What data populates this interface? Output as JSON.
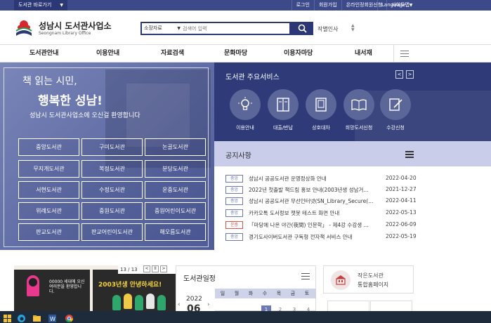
{
  "topbar": {
    "site_select": "도서관 바로가기",
    "links": [
      "로그인",
      "회원가입",
      "온라인정회원신청",
      "사이트맵"
    ],
    "language": "Language"
  },
  "header": {
    "logo_kor": "성남시 도서관사업소",
    "logo_eng": "Seongnam Library Office",
    "search_category": "소장자료",
    "search_placeholder": "검색어 입력",
    "work_label": "작별인사"
  },
  "gnb": {
    "items": [
      "도서관안내",
      "이용안내",
      "자료검색",
      "문화마당",
      "이용자마당",
      "내서재"
    ]
  },
  "hero": {
    "line1": "책 읽는 시민,",
    "line2": "행복한 성남!",
    "line3": "성남시 도서관사업소에 오신걸 환영합니다",
    "branches": [
      "중앙도서관",
      "구미도서관",
      "논골도서관",
      "무지개도서관",
      "복정도서관",
      "분당도서관",
      "서현도서관",
      "수정도서관",
      "운중도서관",
      "위례도서관",
      "중원도서관",
      "중원어린이도서관",
      "판교도서관",
      "판교어린이도서관",
      "해오름도서관"
    ]
  },
  "services": {
    "title": "도서관 주요서비스",
    "items": [
      "이용안내",
      "대출/반납",
      "상호대차",
      "희망도서신청",
      "수강신청"
    ]
  },
  "notice": {
    "title": "공지사항",
    "rows": [
      {
        "badge": "중앙",
        "text": "성남시 공공도서관 운영정상화 안내",
        "date": "2022-04-20",
        "color": "#6c79b4"
      },
      {
        "badge": "중앙",
        "text": "2022년 첫출발 책드림 홍보 안내(2003년생 성남거...",
        "date": "2021-12-27",
        "color": "#6c79b4"
      },
      {
        "badge": "중앙",
        "text": "성남시 공공도서관 무선인터넷(SN_Library_Secure(...",
        "date": "2022-04-11",
        "color": "#6c79b4"
      },
      {
        "badge": "중앙",
        "text": "카카오톡 도서정보 챗봇 테스트 화면 안내",
        "date": "2022-05-13",
        "color": "#6c79b4"
      },
      {
        "badge": "운중",
        "text": "「마당에 나온 야간(夜間) 인문학」 - 제4강 수강생 ...",
        "date": "2022-06-09",
        "color": "#d9534f"
      },
      {
        "badge": "중앙",
        "text": "경기도사이버도서관 구독형 전자책 서비스 안내",
        "date": "2022-05-19",
        "color": "#6c79b4"
      }
    ]
  },
  "banner": {
    "pager": "13 / 13",
    "text_left": "00000 세대에 오신 여러분을 환영합니다.",
    "text_right": "2003년생 안녕하세요!"
  },
  "schedule": {
    "title": "도서관일정",
    "year": "2022",
    "month": "06",
    "weekdays": [
      "일",
      "월",
      "화",
      "수",
      "목",
      "금",
      "토"
    ],
    "days": [
      "1",
      "2",
      "3",
      "4"
    ]
  },
  "small_library": {
    "line1": "작은도서관",
    "line2": "통합홈페이지"
  }
}
